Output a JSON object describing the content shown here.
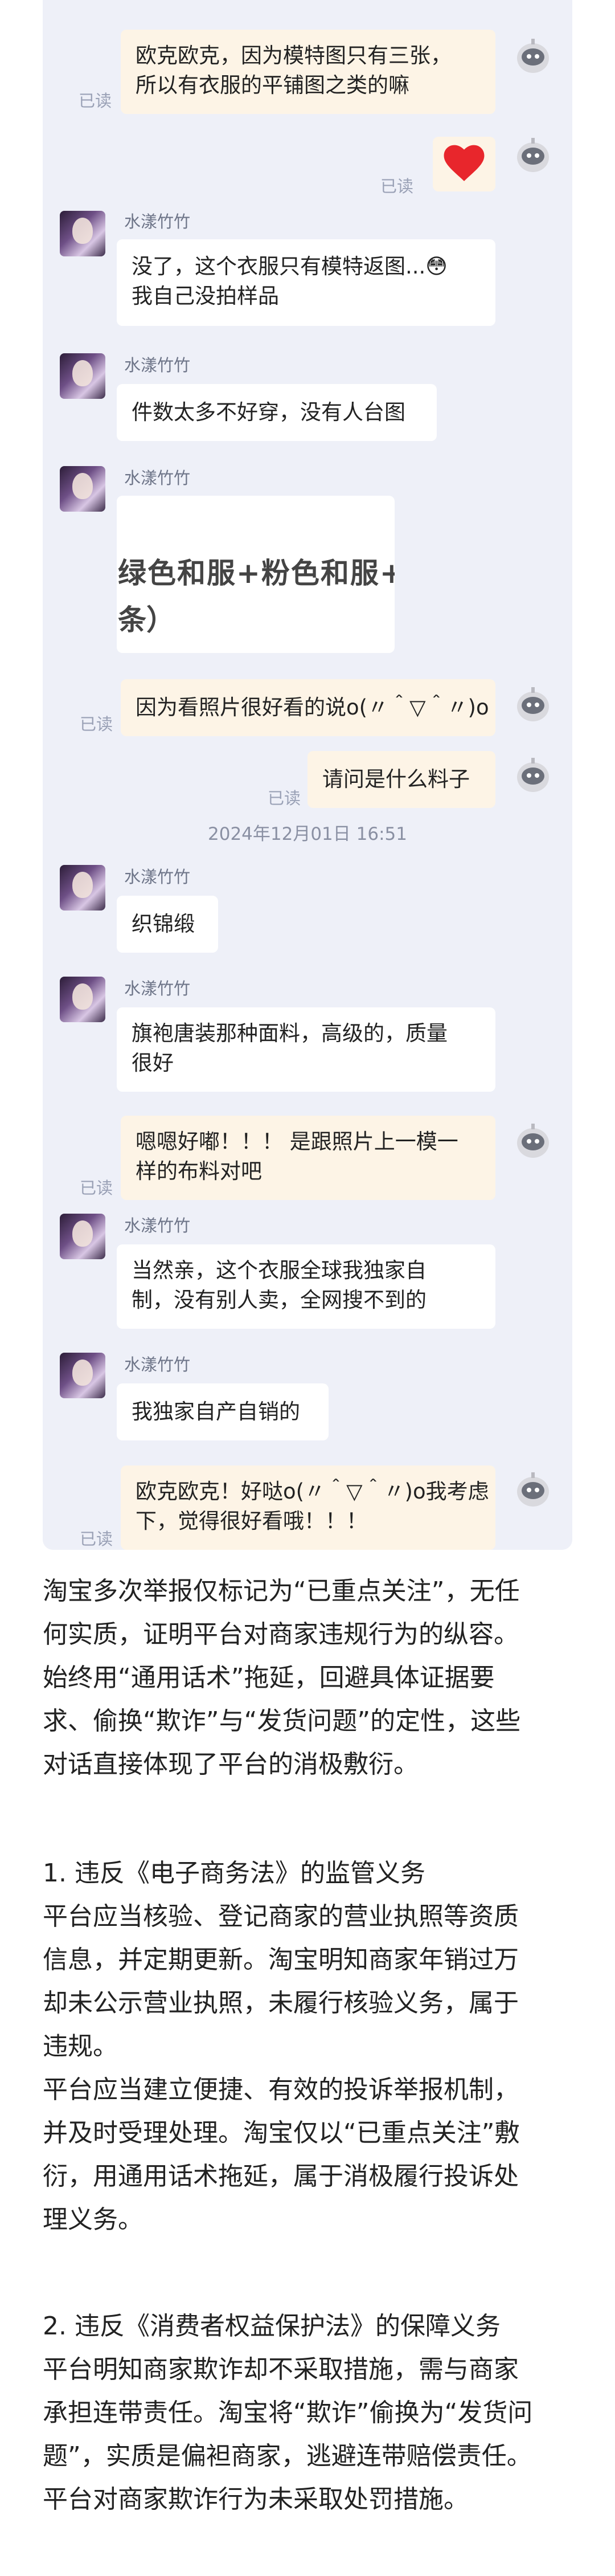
{
  "read_label": "已读",
  "sender_name": "水漾竹竹",
  "timestamp": "2024年12月01日 16:51",
  "messages": {
    "m1": [
      "欧克欧克，因为模特图只有三张，",
      "所以有衣服的平铺图之类的嘛"
    ],
    "m3": [
      "没了，这个衣服只有模特返图...😳",
      "我自己没拍样品"
    ],
    "m4": [
      "件数太多不好穿，没有人台图"
    ],
    "m5_image_text": [
      "绿色和服+粉色和服+",
      "条）"
    ],
    "m6": [
      "因为看照片很好看的说o(〃＾▽＾〃)o"
    ],
    "m7": [
      "请问是什么料子"
    ],
    "m8": [
      "织锦缎"
    ],
    "m9": [
      "旗袍唐装那种面料，高级的，质量",
      "很好"
    ],
    "m10": [
      "嗯嗯好嘟！！！ 是跟照片上一模一",
      "样的布料对吧"
    ],
    "m11": [
      "当然亲，这个衣服全球我独家自",
      "制，没有别人卖，全网搜不到的"
    ],
    "m12": [
      "我独家自产自销的"
    ],
    "m13": [
      "欧克欧克！好哒o(〃＾▽＾〃)o我考虑",
      "下，觉得很好看哦！！！"
    ]
  },
  "article": {
    "intro": [
      "淘宝多次举报仅标记为“已重点关注”，无任",
      "何实质，证明平台对商家违规行为的纵容。",
      "始终用“通用话术”拖延，回避具体证据要",
      "求、偷换“欺诈”与“发货问题”的定性，这些",
      "对话直接体现了平台的消极敷衍。"
    ],
    "section1": [
      "1. 违反《电子商务法》的监管义务",
      "平台应当核验、登记商家的营业执照等资质",
      "信息，并定期更新。淘宝明知商家年销过万",
      "却未公示营业执照，未履行核验义务，属于",
      "违规。",
      "平台应当建立便捷、有效的投诉举报机制，",
      "并及时受理处理。淘宝仅以“已重点关注”敷",
      "衍，用通用话术拖延，属于消极履行投诉处",
      "理义务。"
    ],
    "section2": [
      "2. 违反《消费者权益保护法》的保障义务",
      "平台明知商家欺诈却不采取措施，需与商家",
      "承担连带责任。淘宝将“欺诈”偷换为“发货问",
      "题”，实质是偏袒商家，逃避连带赔偿责任。",
      "平台对商家欺诈行为未采取处罚措施。"
    ]
  },
  "colors": {
    "chat_bg": "#eef0f8",
    "outgoing_bubble": "#fdf4e6",
    "incoming_bubble": "#ffffff",
    "read_text": "#9aa1b6"
  },
  "icons": {
    "self_avatar": "robot-avatar-icon",
    "heart": "red-heart-emoji"
  }
}
